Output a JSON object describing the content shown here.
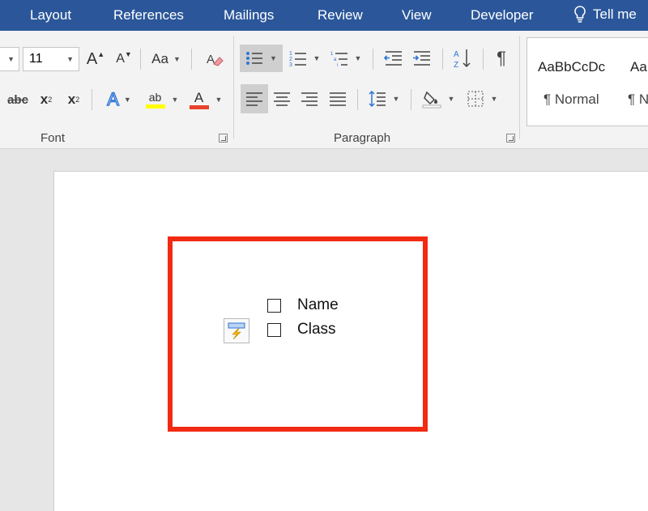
{
  "ribbon_tabs": [
    "Layout",
    "References",
    "Mailings",
    "Review",
    "View",
    "Developer"
  ],
  "tell_me": {
    "label": "Tell me"
  },
  "font_group": {
    "label": "Font",
    "font_size": "11",
    "grow_label": "A",
    "shrink_label": "A",
    "change_case_label": "Aa",
    "strikethrough_label": "abc",
    "subscript_label": "x",
    "subscript_mark": "2",
    "superscript_label": "x",
    "superscript_mark": "2",
    "text_effects_label": "A",
    "highlight_label": "ab",
    "font_color_label": "A"
  },
  "paragraph_group": {
    "label": "Paragraph",
    "pilcrow": "¶"
  },
  "styles_gallery": [
    {
      "sample": "AaBbCcDc",
      "name": "¶ Normal"
    },
    {
      "sample": "Aa",
      "name": "¶ N"
    }
  ],
  "document": {
    "checklist": [
      {
        "label": "Name",
        "checked": false
      },
      {
        "label": "Class",
        "checked": false
      }
    ]
  },
  "colors": {
    "ribbon_tab_bg": "#2b579a",
    "highlight_border": "#f22a12",
    "highlight_yellow": "#ffff00",
    "font_color_red": "#e8432b"
  }
}
